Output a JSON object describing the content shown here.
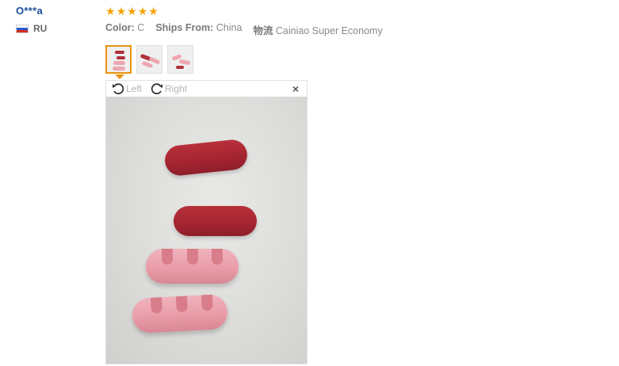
{
  "buyer": {
    "name": "O***a",
    "country": "RU"
  },
  "review": {
    "rating": 5,
    "color_label": "Color:",
    "color_value": "C",
    "ships_label": "Ships From:",
    "ships_value": "China",
    "logistics_label": "物流",
    "logistics_value": "Cainiao Super Economy"
  },
  "photos": {
    "thumbnail_count": 3,
    "active_index": 0
  },
  "viewer": {
    "rotate_left": "Left",
    "rotate_right": "Right",
    "close": "×"
  },
  "icons": {
    "flag": "russia-flag-icon",
    "star": "star-icon",
    "rotate_left": "rotate-left-icon",
    "rotate_right": "rotate-right-icon",
    "close": "close-icon"
  },
  "colors": {
    "star": "#f5a300",
    "active_thumb": "#e8940e",
    "buyer_link": "#1a4f9c"
  }
}
